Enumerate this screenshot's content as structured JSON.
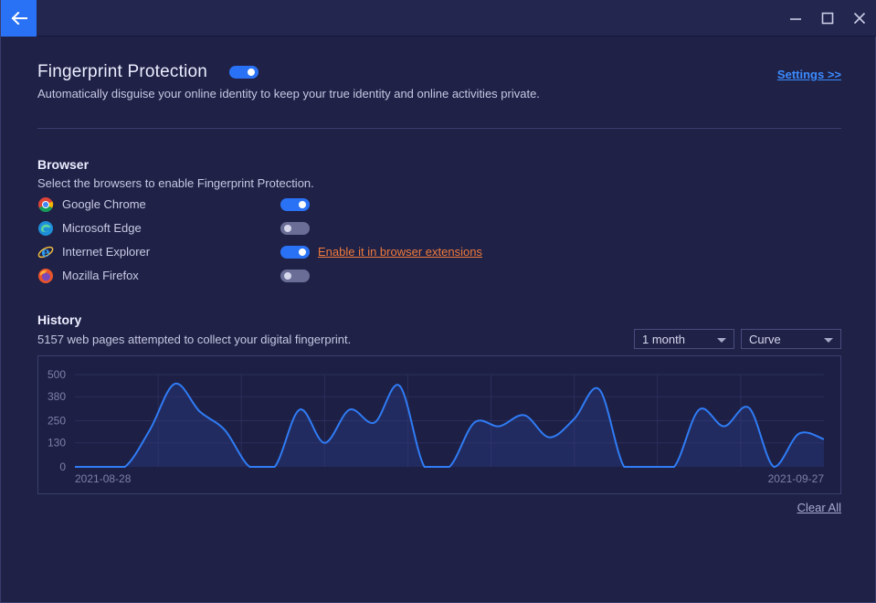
{
  "window": {
    "controls": [
      "minimize-icon",
      "maximize-icon",
      "close-icon"
    ]
  },
  "header": {
    "title": "Fingerprint Protection",
    "enabled": true,
    "subtitle": "Automatically disguise your online identity to keep your true identity and online activities private.",
    "settings_link": "Settings >>"
  },
  "browser": {
    "title": "Browser",
    "subtitle": "Select the browsers to enable Fingerprint Protection.",
    "items": [
      {
        "name": "Google Chrome",
        "icon": "chrome-icon",
        "enabled": true,
        "note": ""
      },
      {
        "name": "Microsoft Edge",
        "icon": "edge-icon",
        "enabled": false,
        "note": ""
      },
      {
        "name": "Internet Explorer",
        "icon": "ie-icon",
        "enabled": true,
        "note": "Enable it in browser extensions"
      },
      {
        "name": "Mozilla Firefox",
        "icon": "firefox-icon",
        "enabled": false,
        "note": ""
      }
    ]
  },
  "history": {
    "title": "History",
    "subtitle": "5157 web pages attempted to collect your digital fingerprint.",
    "range_select": "1 month",
    "style_select": "Curve",
    "clear_all": "Clear All"
  },
  "colors": {
    "accent": "#2a72f5",
    "link_orange": "#f07a3a",
    "background": "#1f2147"
  },
  "chart_data": {
    "type": "area",
    "x": [
      "2021-08-28",
      "2021-08-29",
      "2021-08-30",
      "2021-08-31",
      "2021-09-01",
      "2021-09-02",
      "2021-09-03",
      "2021-09-04",
      "2021-09-05",
      "2021-09-06",
      "2021-09-07",
      "2021-09-08",
      "2021-09-09",
      "2021-09-10",
      "2021-09-11",
      "2021-09-12",
      "2021-09-13",
      "2021-09-14",
      "2021-09-15",
      "2021-09-16",
      "2021-09-17",
      "2021-09-18",
      "2021-09-19",
      "2021-09-20",
      "2021-09-21",
      "2021-09-22",
      "2021-09-23",
      "2021-09-24",
      "2021-09-25",
      "2021-09-26",
      "2021-09-27"
    ],
    "values": [
      0,
      0,
      0,
      200,
      450,
      300,
      200,
      0,
      0,
      310,
      130,
      310,
      240,
      440,
      0,
      0,
      240,
      220,
      280,
      160,
      260,
      420,
      0,
      0,
      0,
      310,
      220,
      320,
      0,
      180,
      150
    ],
    "x_tick_labels": [
      "2021-08-28",
      "2021-09-27"
    ],
    "y_ticks": [
      0,
      130,
      250,
      380,
      500
    ],
    "ylim": [
      0,
      500
    ],
    "grid": true,
    "xlabel": "",
    "ylabel": "",
    "title": ""
  }
}
